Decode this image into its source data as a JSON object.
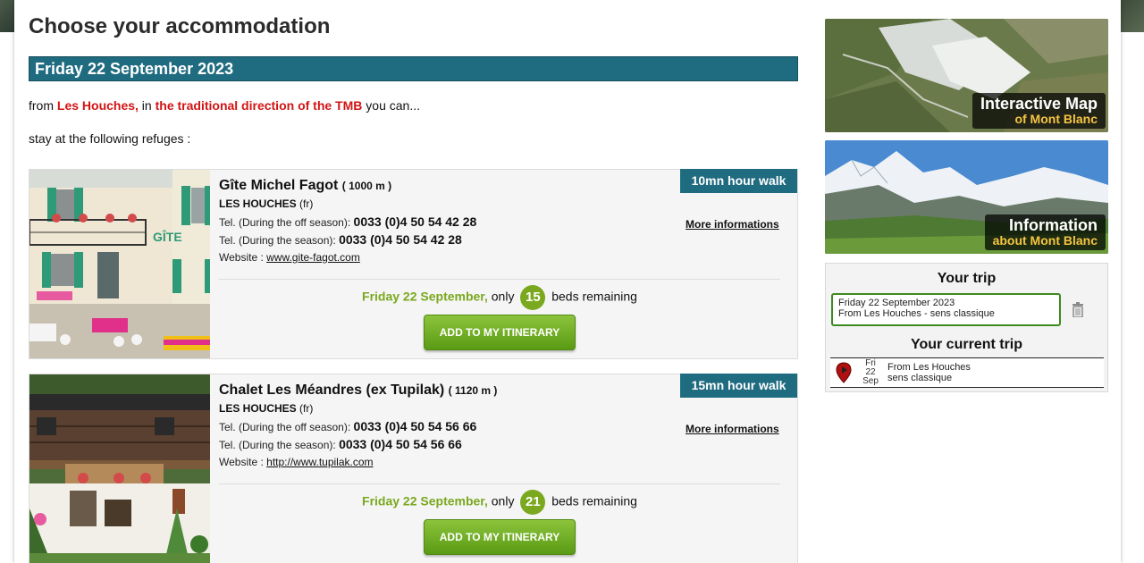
{
  "page": {
    "title": "Choose your accommodation",
    "date_header": "Friday 22 September 2023"
  },
  "intro": {
    "prefix": "from ",
    "start": "Les Houches,",
    "middle": " in ",
    "direction": "the traditional direction of the TMB",
    "suffix": " you can...",
    "line2": "stay at the following refuges :"
  },
  "refuges": [
    {
      "name": "Gîte Michel Fagot",
      "altitude": "( 1000 m )",
      "walk": "10mn hour walk",
      "town": "LES HOUCHES",
      "country": " (fr)",
      "tel_off_label": "Tel. (During the off season): ",
      "tel_off": "0033 (0)4 50 54 42 28",
      "tel_season_label": "Tel. (During the season): ",
      "tel_season": "0033 (0)4 50 54 42 28",
      "website_label": "Website : ",
      "website": "www.gite-fagot.com",
      "more": "More informations",
      "avail_date": "Friday 22 September,",
      "avail_only": " only ",
      "beds": "15",
      "beds_suffix": " beds remaining",
      "button": "ADD TO MY ITINERARY"
    },
    {
      "name": "Chalet Les Méandres (ex Tupilak)",
      "altitude": "( 1120 m )",
      "walk": "15mn hour walk",
      "town": "LES HOUCHES",
      "country": " (fr)",
      "tel_off_label": "Tel. (During the off season): ",
      "tel_off": "0033 (0)4 50 54 56 66",
      "tel_season_label": "Tel. (During the season): ",
      "tel_season": "0033 (0)4 50 54 56 66",
      "website_label": "Website : ",
      "website": "http://www.tupilak.com",
      "more": "More informations",
      "avail_date": "Friday 22 September,",
      "avail_only": " only ",
      "beds": "21",
      "beds_suffix": " beds remaining",
      "button": "ADD TO MY ITINERARY"
    }
  ],
  "sidebar": {
    "map_title": "Interactive Map",
    "map_subtitle": "of Mont Blanc",
    "info_title": "Information",
    "info_subtitle": "about Mont Blanc",
    "trip_title": "Your trip",
    "trip_date": "Friday 22 September 2023",
    "trip_from": "From Les Houches - sens classique",
    "current_title": "Your current trip",
    "cal_day": "Fri",
    "cal_num": "22",
    "cal_month": "Sep",
    "current_line1": "From Les Houches",
    "current_line2": "sens classique"
  },
  "colors": {
    "header_bar": "#1f6b80",
    "accent_red": "#d21414",
    "accent_green": "#7aa81f"
  }
}
